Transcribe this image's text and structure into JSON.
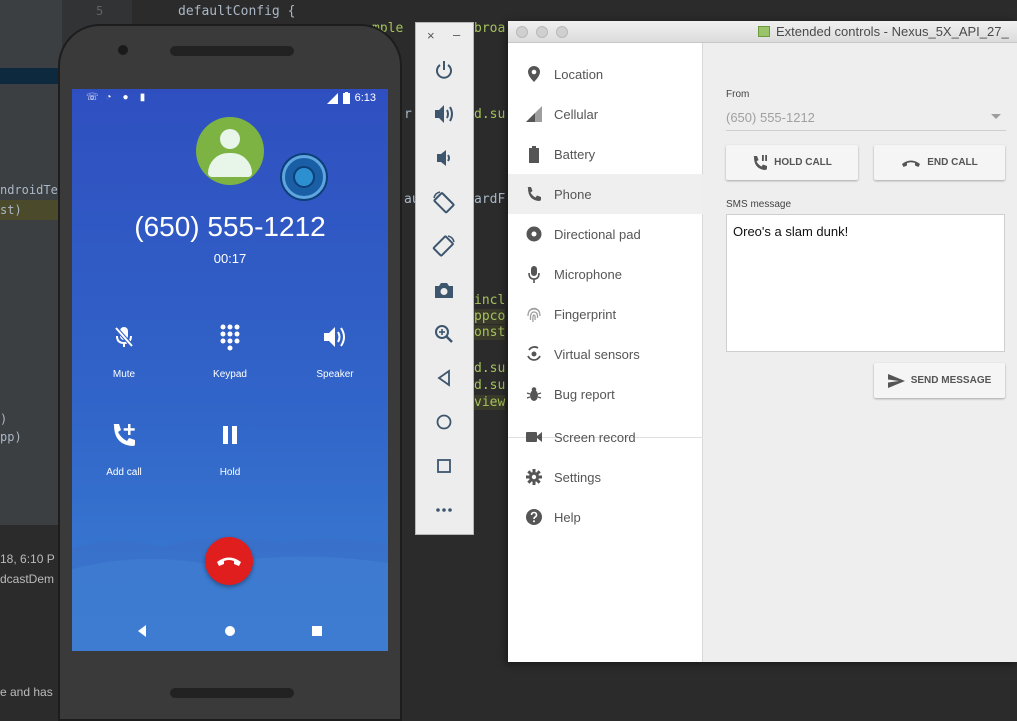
{
  "ide": {
    "line_number": "5",
    "code_line": "defaultConfig {",
    "fragments": [
      "mple",
      "broa",
      "r",
      "d.su",
      "au",
      "ardF",
      "incl",
      "ppco",
      "onst",
      "d.su",
      "d.su",
      "view"
    ],
    "side_text": [
      "ndroidTes",
      "st)",
      ")",
      "pp)"
    ],
    "bottom_text": [
      "18, 6:10 P",
      "dcastDem",
      "e and has"
    ]
  },
  "phone": {
    "status": {
      "time": "6:13"
    },
    "call": {
      "number": "(650) 555-1212",
      "timer": "00:17",
      "buttons": [
        {
          "label": "Mute",
          "icon": "mic-off-icon"
        },
        {
          "label": "Keypad",
          "icon": "dialpad-icon"
        },
        {
          "label": "Speaker",
          "icon": "volume-icon"
        },
        {
          "label": "Add call",
          "icon": "add-call-icon"
        },
        {
          "label": "Hold",
          "icon": "pause-icon"
        }
      ]
    }
  },
  "toolbar": {
    "close": "×",
    "minimize": "–",
    "buttons": [
      "power-icon",
      "volume-up-icon",
      "volume-down-icon",
      "rotate-left-icon",
      "rotate-right-icon",
      "camera-icon",
      "zoom-icon",
      "back-icon",
      "home-icon",
      "overview-icon",
      "more-icon"
    ]
  },
  "ext": {
    "title": "Extended controls - Nexus_5X_API_27_",
    "sidebar": [
      {
        "label": "Location",
        "icon": "location-pin-icon"
      },
      {
        "label": "Cellular",
        "icon": "signal-icon"
      },
      {
        "label": "Battery",
        "icon": "battery-icon"
      },
      {
        "label": "Phone",
        "icon": "phone-icon"
      },
      {
        "label": "Directional pad",
        "icon": "dpad-icon"
      },
      {
        "label": "Microphone",
        "icon": "microphone-icon"
      },
      {
        "label": "Fingerprint",
        "icon": "fingerprint-icon"
      },
      {
        "label": "Virtual sensors",
        "icon": "virtual-sensors-icon"
      },
      {
        "label": "Bug report",
        "icon": "bug-icon"
      },
      {
        "label": "Screen record",
        "icon": "videocam-icon"
      },
      {
        "label": "Settings",
        "icon": "gear-icon"
      },
      {
        "label": "Help",
        "icon": "help-icon"
      }
    ],
    "active_item": "Phone",
    "phone": {
      "from_label": "From",
      "from_value": "(650) 555-1212",
      "hold_call": "HOLD CALL",
      "end_call": "END CALL",
      "sms_label": "SMS message",
      "sms_text": "Oreo's a slam dunk!",
      "send_message": "SEND MESSAGE"
    }
  }
}
